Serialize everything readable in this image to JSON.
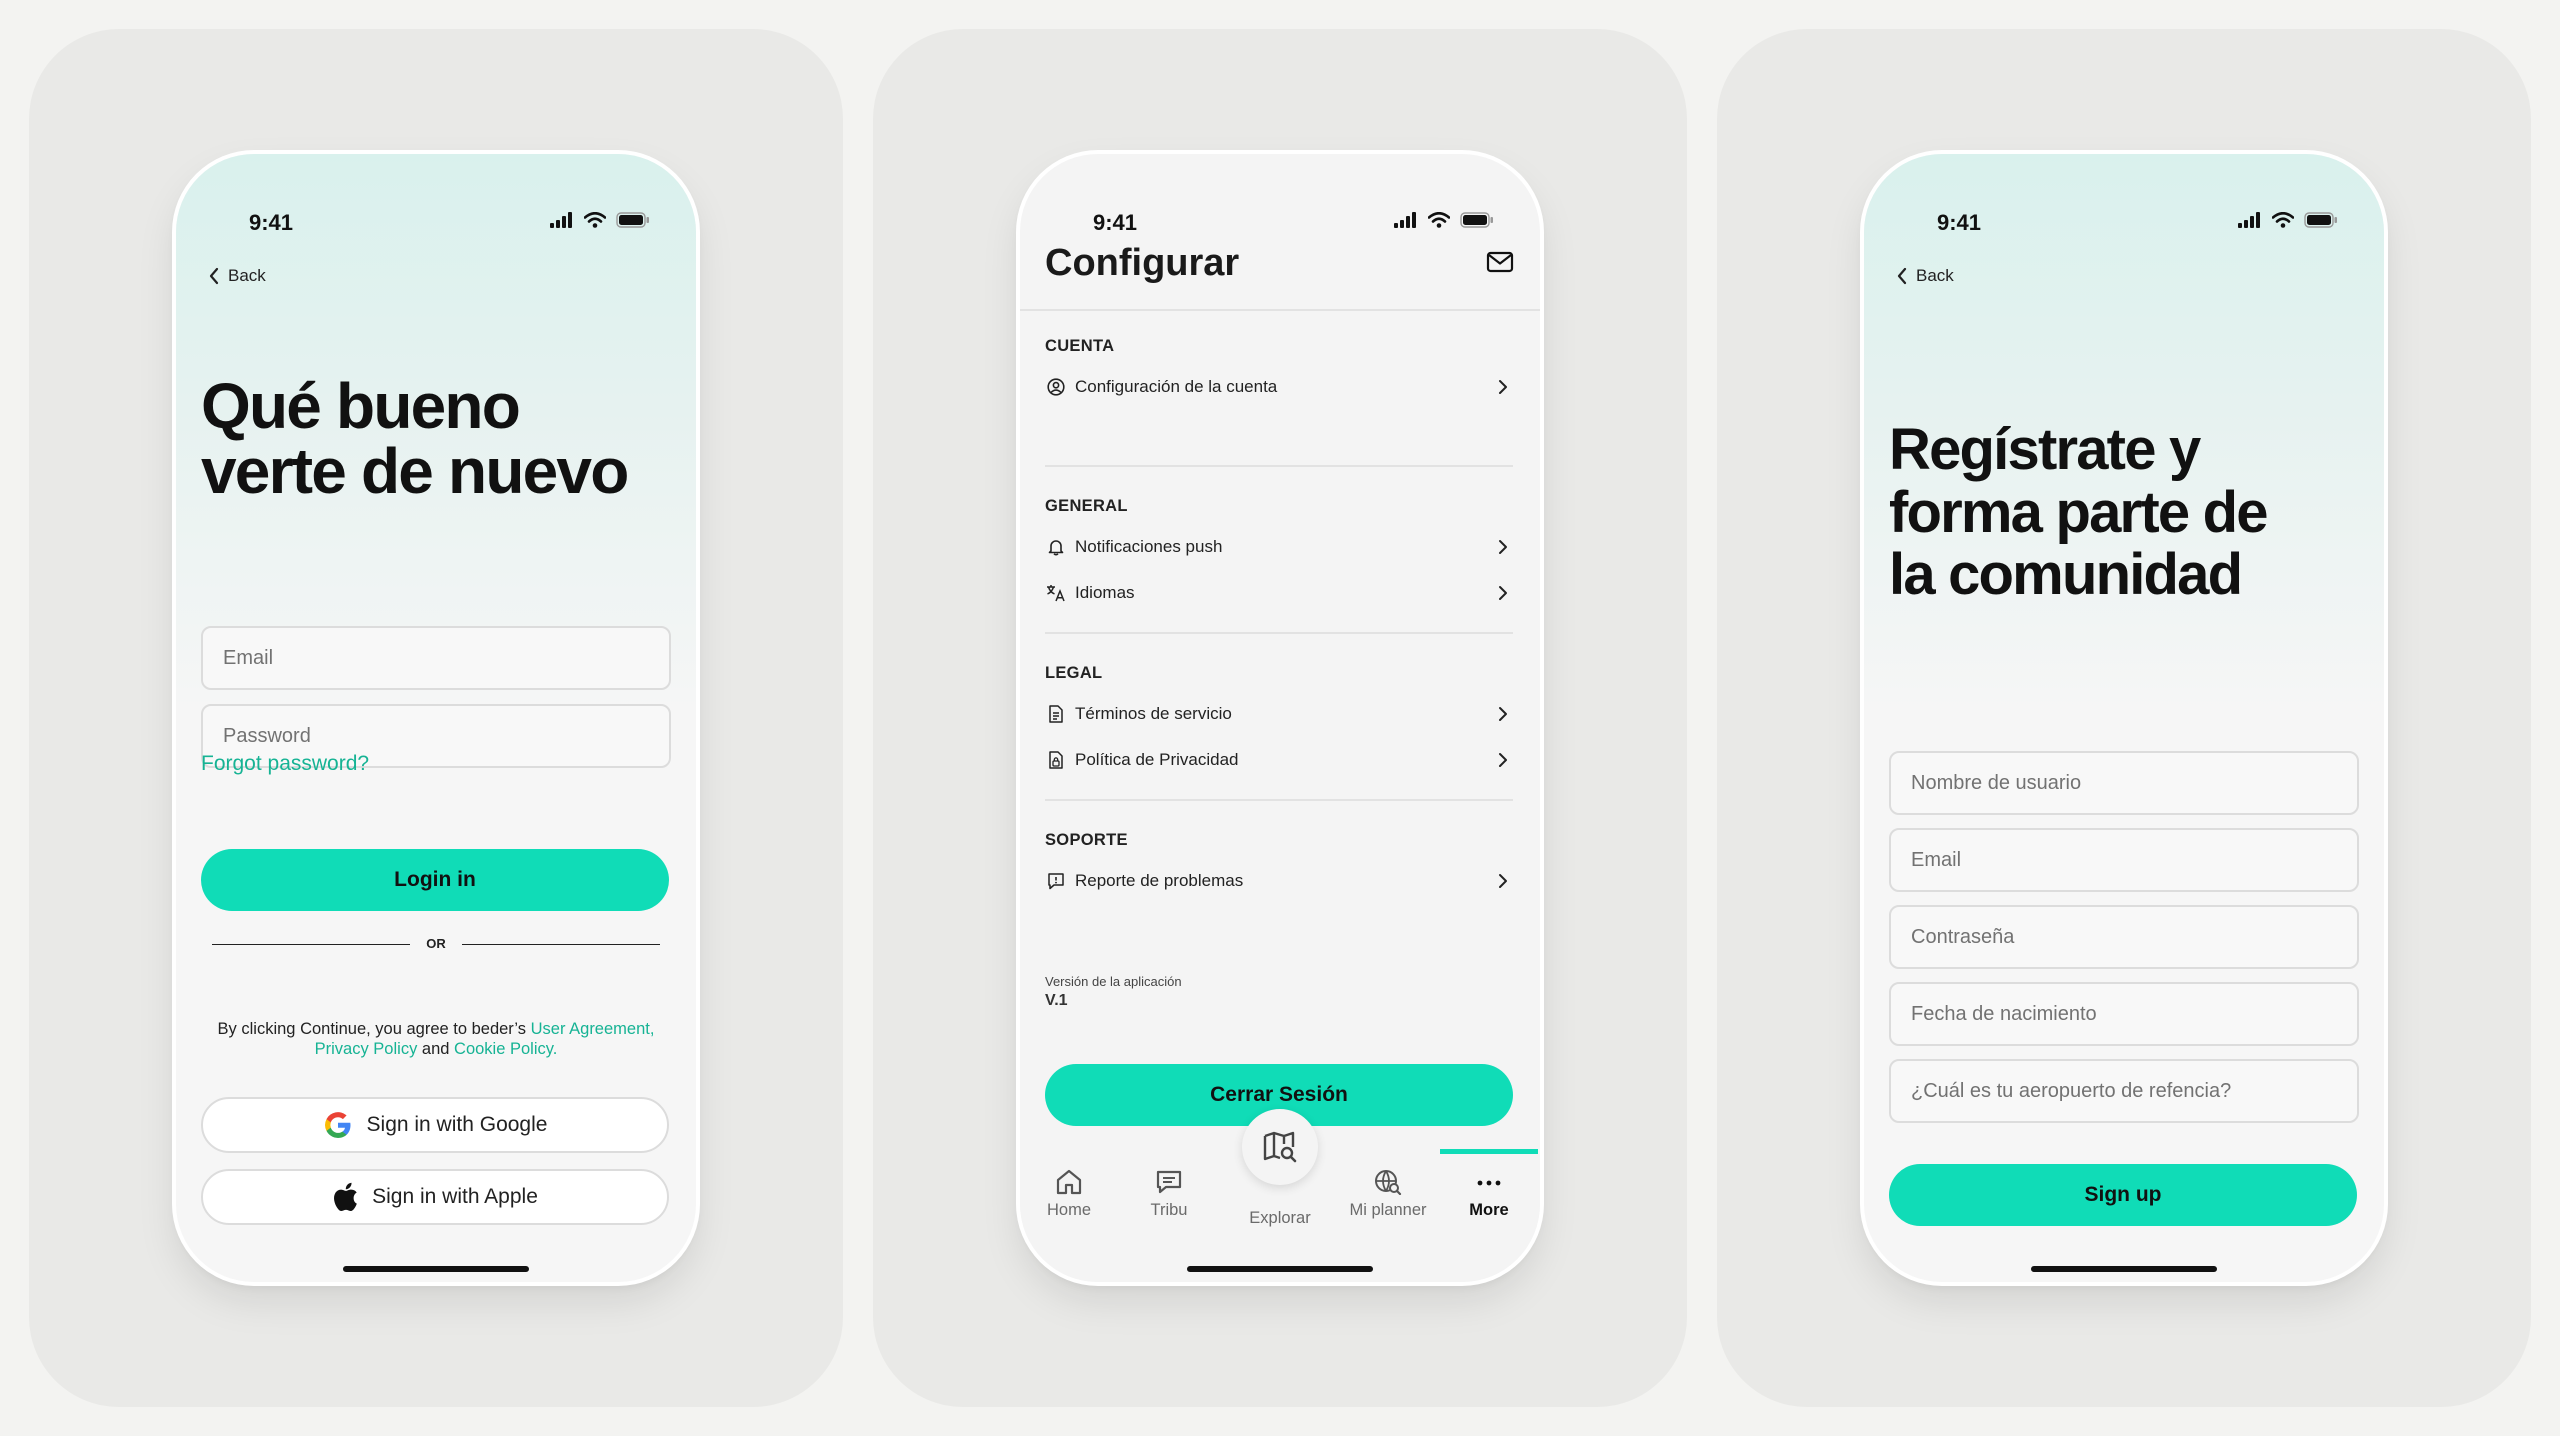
{
  "status": {
    "time": "9:41"
  },
  "login": {
    "back": "Back",
    "title_line1": "Qué bueno",
    "title_line2": "verte de nuevo",
    "email_placeholder": "Email",
    "password_placeholder": "Password",
    "forgot": "Forgot password?",
    "login_button": "Login in",
    "or": "OR",
    "terms_prefix": "By clicking Continue, you agree to beder’s ",
    "terms_user_agreement": "User Agreement",
    "terms_sep": ", ",
    "terms_privacy": "Privacy Policy",
    "terms_and": " and ",
    "terms_cookie": "Cookie Policy.",
    "google_button": "Sign in with Google",
    "apple_button": "Sign in with Apple"
  },
  "settings": {
    "title": "Configurar",
    "sections": [
      {
        "header": "CUENTA",
        "items": [
          "Configuración de la cuenta"
        ]
      },
      {
        "header": "GENERAL",
        "items": [
          "Notificaciones push",
          "Idiomas"
        ]
      },
      {
        "header": "LEGAL",
        "items": [
          "Términos de servicio",
          "Política de Privacidad"
        ]
      },
      {
        "header": "SOPORTE",
        "items": [
          "Reporte de problemas"
        ]
      }
    ],
    "version_label": "Versión de la aplicación",
    "version_value": "V.1",
    "logout_button": "Cerrar Sesión",
    "tabs": [
      "Home",
      "Tribu",
      "Explorar",
      "Mi planner",
      "More"
    ],
    "active_tab": "More"
  },
  "signup": {
    "back": "Back",
    "title_line1": "Regístrate y",
    "title_line2": "forma parte de",
    "title_line3": "la comunidad",
    "fields": [
      "Nombre de usuario",
      "Email",
      "Contraseña",
      "Fecha de nacimiento",
      "¿Cuál es tu aeropuerto de refencia?"
    ],
    "signup_button": "Sign up"
  },
  "colors": {
    "accent": "#10dcb7",
    "link": "#16b394",
    "card_bg": "#e9e9e7",
    "page_bg": "#f3f3f1"
  }
}
